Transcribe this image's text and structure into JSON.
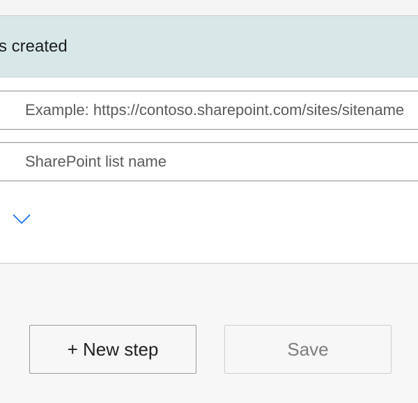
{
  "trigger": {
    "title": "s created"
  },
  "fields": {
    "site_address": {
      "placeholder": "Example: https://contoso.sharepoint.com/sites/sitename"
    },
    "list_name": {
      "placeholder": "SharePoint list name"
    }
  },
  "advanced_options": {
    "icon": "chevron-down-icon"
  },
  "actions": {
    "new_step_label": "+ New step",
    "save_label": "Save"
  },
  "colors": {
    "header_bg": "#d8e8e8",
    "chevron": "#1a73e8",
    "page_bg": "#f7f7f7"
  }
}
